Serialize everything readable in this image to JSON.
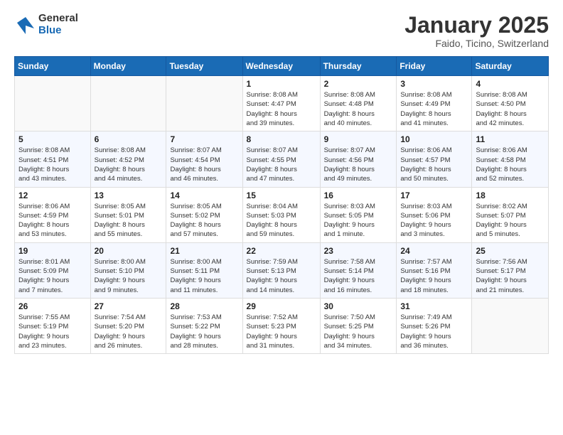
{
  "header": {
    "logo_general": "General",
    "logo_blue": "Blue",
    "title": "January 2025",
    "location": "Faido, Ticino, Switzerland"
  },
  "days_of_week": [
    "Sunday",
    "Monday",
    "Tuesday",
    "Wednesday",
    "Thursday",
    "Friday",
    "Saturday"
  ],
  "weeks": [
    [
      {
        "day": "",
        "info": ""
      },
      {
        "day": "",
        "info": ""
      },
      {
        "day": "",
        "info": ""
      },
      {
        "day": "1",
        "info": "Sunrise: 8:08 AM\nSunset: 4:47 PM\nDaylight: 8 hours\nand 39 minutes."
      },
      {
        "day": "2",
        "info": "Sunrise: 8:08 AM\nSunset: 4:48 PM\nDaylight: 8 hours\nand 40 minutes."
      },
      {
        "day": "3",
        "info": "Sunrise: 8:08 AM\nSunset: 4:49 PM\nDaylight: 8 hours\nand 41 minutes."
      },
      {
        "day": "4",
        "info": "Sunrise: 8:08 AM\nSunset: 4:50 PM\nDaylight: 8 hours\nand 42 minutes."
      }
    ],
    [
      {
        "day": "5",
        "info": "Sunrise: 8:08 AM\nSunset: 4:51 PM\nDaylight: 8 hours\nand 43 minutes."
      },
      {
        "day": "6",
        "info": "Sunrise: 8:08 AM\nSunset: 4:52 PM\nDaylight: 8 hours\nand 44 minutes."
      },
      {
        "day": "7",
        "info": "Sunrise: 8:07 AM\nSunset: 4:54 PM\nDaylight: 8 hours\nand 46 minutes."
      },
      {
        "day": "8",
        "info": "Sunrise: 8:07 AM\nSunset: 4:55 PM\nDaylight: 8 hours\nand 47 minutes."
      },
      {
        "day": "9",
        "info": "Sunrise: 8:07 AM\nSunset: 4:56 PM\nDaylight: 8 hours\nand 49 minutes."
      },
      {
        "day": "10",
        "info": "Sunrise: 8:06 AM\nSunset: 4:57 PM\nDaylight: 8 hours\nand 50 minutes."
      },
      {
        "day": "11",
        "info": "Sunrise: 8:06 AM\nSunset: 4:58 PM\nDaylight: 8 hours\nand 52 minutes."
      }
    ],
    [
      {
        "day": "12",
        "info": "Sunrise: 8:06 AM\nSunset: 4:59 PM\nDaylight: 8 hours\nand 53 minutes."
      },
      {
        "day": "13",
        "info": "Sunrise: 8:05 AM\nSunset: 5:01 PM\nDaylight: 8 hours\nand 55 minutes."
      },
      {
        "day": "14",
        "info": "Sunrise: 8:05 AM\nSunset: 5:02 PM\nDaylight: 8 hours\nand 57 minutes."
      },
      {
        "day": "15",
        "info": "Sunrise: 8:04 AM\nSunset: 5:03 PM\nDaylight: 8 hours\nand 59 minutes."
      },
      {
        "day": "16",
        "info": "Sunrise: 8:03 AM\nSunset: 5:05 PM\nDaylight: 9 hours\nand 1 minute."
      },
      {
        "day": "17",
        "info": "Sunrise: 8:03 AM\nSunset: 5:06 PM\nDaylight: 9 hours\nand 3 minutes."
      },
      {
        "day": "18",
        "info": "Sunrise: 8:02 AM\nSunset: 5:07 PM\nDaylight: 9 hours\nand 5 minutes."
      }
    ],
    [
      {
        "day": "19",
        "info": "Sunrise: 8:01 AM\nSunset: 5:09 PM\nDaylight: 9 hours\nand 7 minutes."
      },
      {
        "day": "20",
        "info": "Sunrise: 8:00 AM\nSunset: 5:10 PM\nDaylight: 9 hours\nand 9 minutes."
      },
      {
        "day": "21",
        "info": "Sunrise: 8:00 AM\nSunset: 5:11 PM\nDaylight: 9 hours\nand 11 minutes."
      },
      {
        "day": "22",
        "info": "Sunrise: 7:59 AM\nSunset: 5:13 PM\nDaylight: 9 hours\nand 14 minutes."
      },
      {
        "day": "23",
        "info": "Sunrise: 7:58 AM\nSunset: 5:14 PM\nDaylight: 9 hours\nand 16 minutes."
      },
      {
        "day": "24",
        "info": "Sunrise: 7:57 AM\nSunset: 5:16 PM\nDaylight: 9 hours\nand 18 minutes."
      },
      {
        "day": "25",
        "info": "Sunrise: 7:56 AM\nSunset: 5:17 PM\nDaylight: 9 hours\nand 21 minutes."
      }
    ],
    [
      {
        "day": "26",
        "info": "Sunrise: 7:55 AM\nSunset: 5:19 PM\nDaylight: 9 hours\nand 23 minutes."
      },
      {
        "day": "27",
        "info": "Sunrise: 7:54 AM\nSunset: 5:20 PM\nDaylight: 9 hours\nand 26 minutes."
      },
      {
        "day": "28",
        "info": "Sunrise: 7:53 AM\nSunset: 5:22 PM\nDaylight: 9 hours\nand 28 minutes."
      },
      {
        "day": "29",
        "info": "Sunrise: 7:52 AM\nSunset: 5:23 PM\nDaylight: 9 hours\nand 31 minutes."
      },
      {
        "day": "30",
        "info": "Sunrise: 7:50 AM\nSunset: 5:25 PM\nDaylight: 9 hours\nand 34 minutes."
      },
      {
        "day": "31",
        "info": "Sunrise: 7:49 AM\nSunset: 5:26 PM\nDaylight: 9 hours\nand 36 minutes."
      },
      {
        "day": "",
        "info": ""
      }
    ]
  ]
}
